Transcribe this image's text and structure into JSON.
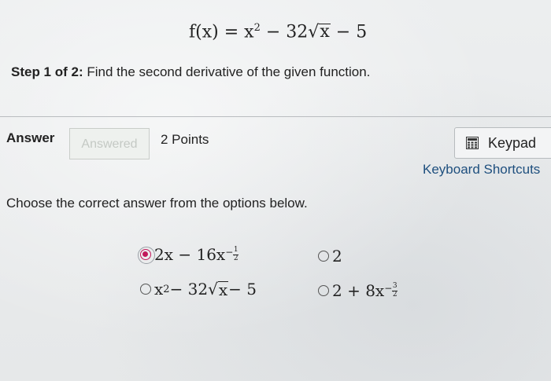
{
  "problem": {
    "function_lhs": "f(x)",
    "equals": "=",
    "term1": "x",
    "term1_exp": "2",
    "minus1": "−",
    "coef": "32",
    "radical_arg": "x",
    "minus2": "−",
    "constant": "5"
  },
  "step": {
    "label": "Step 1 of 2:",
    "text": " Find the second derivative of the given function."
  },
  "answer": {
    "label": "Answer",
    "status": "Answered",
    "points": "2 Points"
  },
  "tools": {
    "keypad_label": "Keypad",
    "keypad_icon": "calculator-icon",
    "shortcuts_label": "Keyboard Shortcuts"
  },
  "instruction": "Choose the correct answer from the options below.",
  "options": [
    {
      "id": "a",
      "selected": true,
      "parts": {
        "t1": "2x − 16x",
        "exp_sign": "−",
        "exp_num": "1",
        "exp_den": "2"
      }
    },
    {
      "id": "b",
      "selected": false,
      "parts": {
        "t1": "2"
      }
    },
    {
      "id": "c",
      "selected": false,
      "parts": {
        "t1": "x",
        "t1_exp": "2",
        "mid": " − 32",
        "radical_arg": "x",
        "tail": " − 5"
      }
    },
    {
      "id": "d",
      "selected": false,
      "parts": {
        "t1": "2 + 8x",
        "exp_sign": "−",
        "exp_num": "3",
        "exp_den": "2"
      }
    }
  ],
  "colors": {
    "selected_radio": "#c2185b",
    "link": "#1e4f7e"
  }
}
